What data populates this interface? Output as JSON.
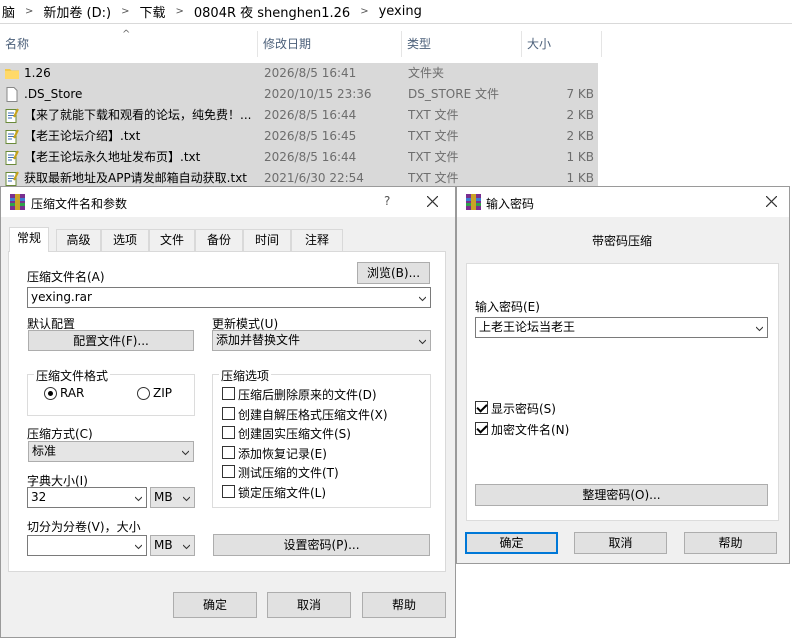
{
  "explorer": {
    "breadcrumb": [
      "脑",
      "新加卷 (D:)",
      "下载",
      "0804R 夜 shenghen1.26",
      "yexing"
    ],
    "columns": {
      "name": "名称",
      "date": "修改日期",
      "type": "类型",
      "size": "大小"
    },
    "files": [
      {
        "icon": "folder-icon",
        "name": "1.26",
        "date": "2026/8/5 16:41",
        "type": "文件夹",
        "size": ""
      },
      {
        "icon": "blank-file-icon",
        "name": ".DS_Store",
        "date": "2020/10/15 23:36",
        "type": "DS_STORE 文件",
        "size": "7 KB"
      },
      {
        "icon": "text-file-icon",
        "name": "【来了就能下载和观看的论坛，纯免费！...",
        "date": "2026/8/5 16:44",
        "type": "TXT 文件",
        "size": "2 KB"
      },
      {
        "icon": "text-file-icon",
        "name": "【老王论坛介绍】.txt",
        "date": "2026/8/5 16:45",
        "type": "TXT 文件",
        "size": "2 KB"
      },
      {
        "icon": "text-file-icon",
        "name": "【老王论坛永久地址发布页】.txt",
        "date": "2026/8/5 16:44",
        "type": "TXT 文件",
        "size": "1 KB"
      },
      {
        "icon": "text-file-icon",
        "name": "获取最新地址及APP请发邮箱自动获取.txt",
        "date": "2021/6/30 22:54",
        "type": "TXT 文件",
        "size": "1 KB"
      }
    ]
  },
  "archive_dialog": {
    "title": "压缩文件名和参数",
    "help_label": "?",
    "tabs": [
      "常规",
      "高级",
      "选项",
      "文件",
      "备份",
      "时间",
      "注释"
    ],
    "archive_name_label": "压缩文件名(A)",
    "browse_label": "浏览(B)...",
    "archive_name_value": "yexing.rar",
    "default_profile_label": "默认配置",
    "profiles_button": "配置文件(F)...",
    "update_mode_label": "更新模式(U)",
    "update_mode_value": "添加并替换文件",
    "format_group_label": "压缩文件格式",
    "format_rar": "RAR",
    "format_zip": "ZIP",
    "options_group_label": "压缩选项",
    "options": [
      {
        "label": "压缩后删除原来的文件(D)",
        "checked": false
      },
      {
        "label": "创建自解压格式压缩文件(X)",
        "checked": false
      },
      {
        "label": "创建固实压缩文件(S)",
        "checked": false
      },
      {
        "label": "添加恢复记录(E)",
        "checked": false
      },
      {
        "label": "测试压缩的文件(T)",
        "checked": false
      },
      {
        "label": "锁定压缩文件(L)",
        "checked": false
      }
    ],
    "method_label": "压缩方式(C)",
    "method_value": "标准",
    "dict_label": "字典大小(I)",
    "dict_value": "32",
    "dict_unit": "MB",
    "split_label": "切分为分卷(V)，大小",
    "split_value": "",
    "split_unit": "MB",
    "set_password_button": "设置密码(P)...",
    "ok_button": "确定",
    "cancel_button": "取消",
    "help_button": "帮助"
  },
  "password_dialog": {
    "title": "输入密码",
    "heading": "带密码压缩",
    "password_label": "输入密码(E)",
    "password_value": "上老王论坛当老王",
    "show_password_label": "显示密码(S)",
    "encrypt_names_label": "加密文件名(N)",
    "organize_button": "整理密码(O)...",
    "ok_button": "确定",
    "cancel_button": "取消",
    "help_button": "帮助"
  },
  "colors": {
    "selection": "#d9d9d9",
    "accent": "#0078d7",
    "dialog_bg": "#f0f0f0"
  }
}
